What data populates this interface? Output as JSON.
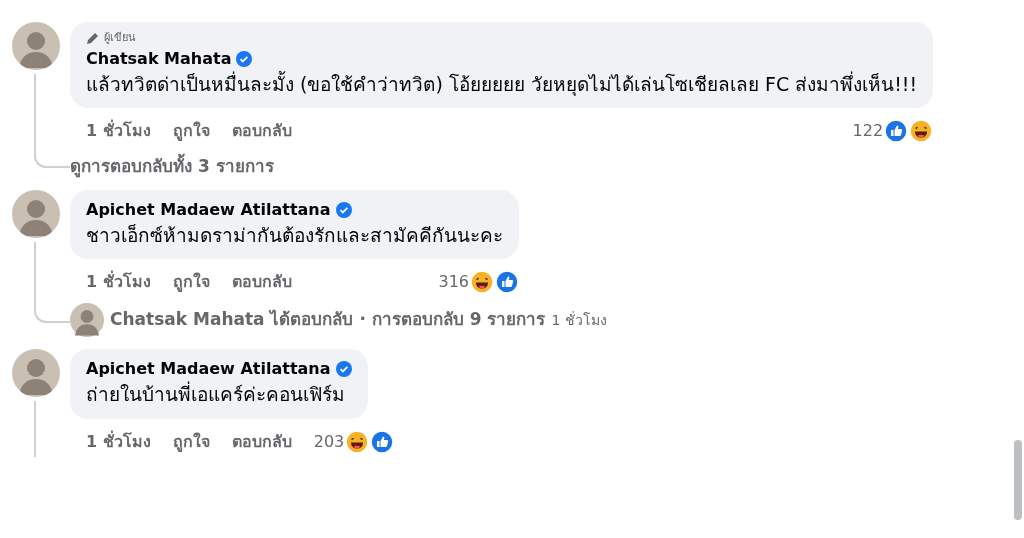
{
  "comments": [
    {
      "author_badge": "ผู้เขียน",
      "author": "Chatsak Mahata",
      "verified": true,
      "text": "แล้วทวิตด่าเป็นหมื่นละมั้ง (ขอใช้คำว่าทวิต) โอ้ยยยยย วัยหยุดไม่ได้เล่นโซเชียลเลย FC ส่งมาพึ่งเห็น!!!",
      "time": "1 ชั่วโมง",
      "actions": [
        "ถูกใจ",
        "ตอบกลับ"
      ],
      "reaction_count": "122",
      "reactions": [
        {
          "kind": "like"
        },
        {
          "kind": "haha"
        }
      ],
      "view_replies": "ดูการตอบกลับทั้ง 3 รายการ"
    },
    {
      "author": "Apichet Madaew Atilattana",
      "verified": true,
      "text": "ชาวเอ็กซ์ห้ามดราม่ากันต้องรักและสามัคคีกันนะคะ",
      "time": "1 ชั่วโมง",
      "actions": [
        "ถูกใจ",
        "ตอบกลับ"
      ],
      "reaction_count": "316",
      "reactions": [
        {
          "kind": "haha"
        },
        {
          "kind": "like"
        }
      ],
      "reply_summary": {
        "name": "Chatsak Mahata",
        "action": "ได้ตอบกลับ",
        "separator": "·",
        "count": "การตอบกลับ 9 รายการ",
        "time": "1 ชั่วโมง"
      }
    },
    {
      "author": "Apichet Madaew Atilattana",
      "verified": true,
      "text": "ถ่ายในบ้านพี่เอแคร์ค่ะคอนเฟิร์ม",
      "time": "1 ชั่วโมง",
      "actions": [
        "ถูกใจ",
        "ตอบกลับ"
      ],
      "reaction_count": "203",
      "reactions": [
        {
          "kind": "haha"
        },
        {
          "kind": "like"
        }
      ]
    }
  ]
}
